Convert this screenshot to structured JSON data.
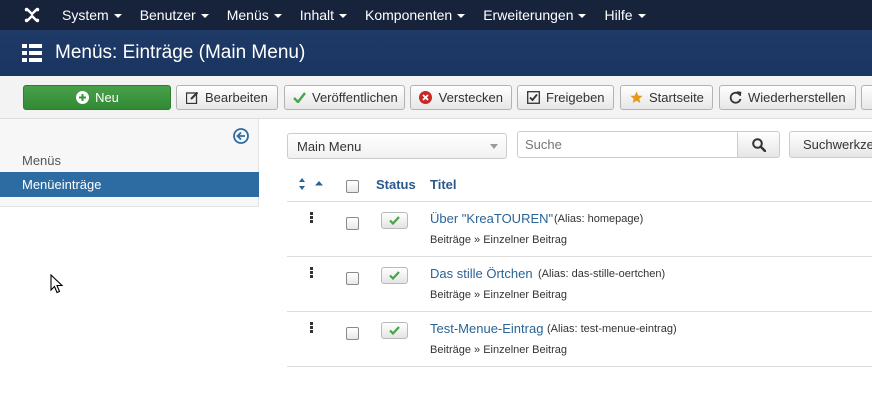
{
  "topnav": {
    "logo_icon": "joomla-logo-icon",
    "items": [
      "System",
      "Benutzer",
      "Menüs",
      "Inhalt",
      "Komponenten",
      "Erweiterungen",
      "Hilfe"
    ]
  },
  "header": {
    "icon": "list-icon",
    "title": "Menüs: Einträge (Main Menu)"
  },
  "toolbar": {
    "new_label": "Neu",
    "edit_label": "Bearbeiten",
    "publish_label": "Veröffentlichen",
    "unpublish_label": "Verstecken",
    "checkin_label": "Freigeben",
    "home_label": "Startseite",
    "rebuild_label": "Wiederherstellen"
  },
  "sidebar": {
    "items": [
      {
        "label": "Menüs",
        "active": false
      },
      {
        "label": "Menüeinträge",
        "active": true
      }
    ]
  },
  "filters": {
    "menu_selected": "Main Menu",
    "search_placeholder": "Suche",
    "tools_label": "Suchwerkzeuge"
  },
  "table": {
    "headers": {
      "status": "Status",
      "title": "Titel"
    },
    "rows": [
      {
        "title": "Über \"KreaTOUREN\"",
        "alias": "(Alias: homepage)",
        "sub": "Beiträge » Einzelner Beitrag",
        "published": true
      },
      {
        "title": "Das stille Örtchen",
        "alias": "(Alias: das-stille-oertchen)",
        "sub": "Beiträge » Einzelner Beitrag",
        "published": true
      },
      {
        "title": "Test-Menue-Eintrag",
        "alias": "(Alias: test-menue-eintrag)",
        "sub": "Beiträge » Einzelner Beitrag",
        "published": true
      }
    ]
  },
  "colors": {
    "topnav_bg": "#17233b",
    "header_bg": "#1f3a67",
    "primary": "#2d6ca2",
    "success": "#46a546"
  }
}
